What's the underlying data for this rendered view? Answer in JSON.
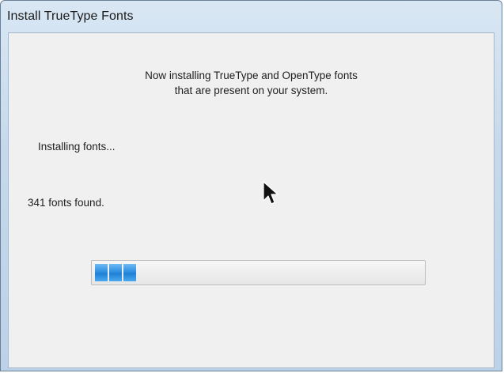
{
  "window": {
    "title": "Install TrueType Fonts"
  },
  "dialog": {
    "heading_line1": "Now installing TrueType and OpenType fonts",
    "heading_line2": "that are present on your system.",
    "status_text": "Installing fonts...",
    "fonts_found_text": "341 fonts found."
  },
  "progress": {
    "fraction": 0.13,
    "chunks_visible": 3,
    "fill_color": "#2f8fe0"
  },
  "colors": {
    "titlebar": "#c6d9ec",
    "client_bg": "#f0f0f0",
    "progress_fill": "#2f8fe0"
  },
  "icons": {
    "cursor": "mouse-pointer-icon"
  }
}
